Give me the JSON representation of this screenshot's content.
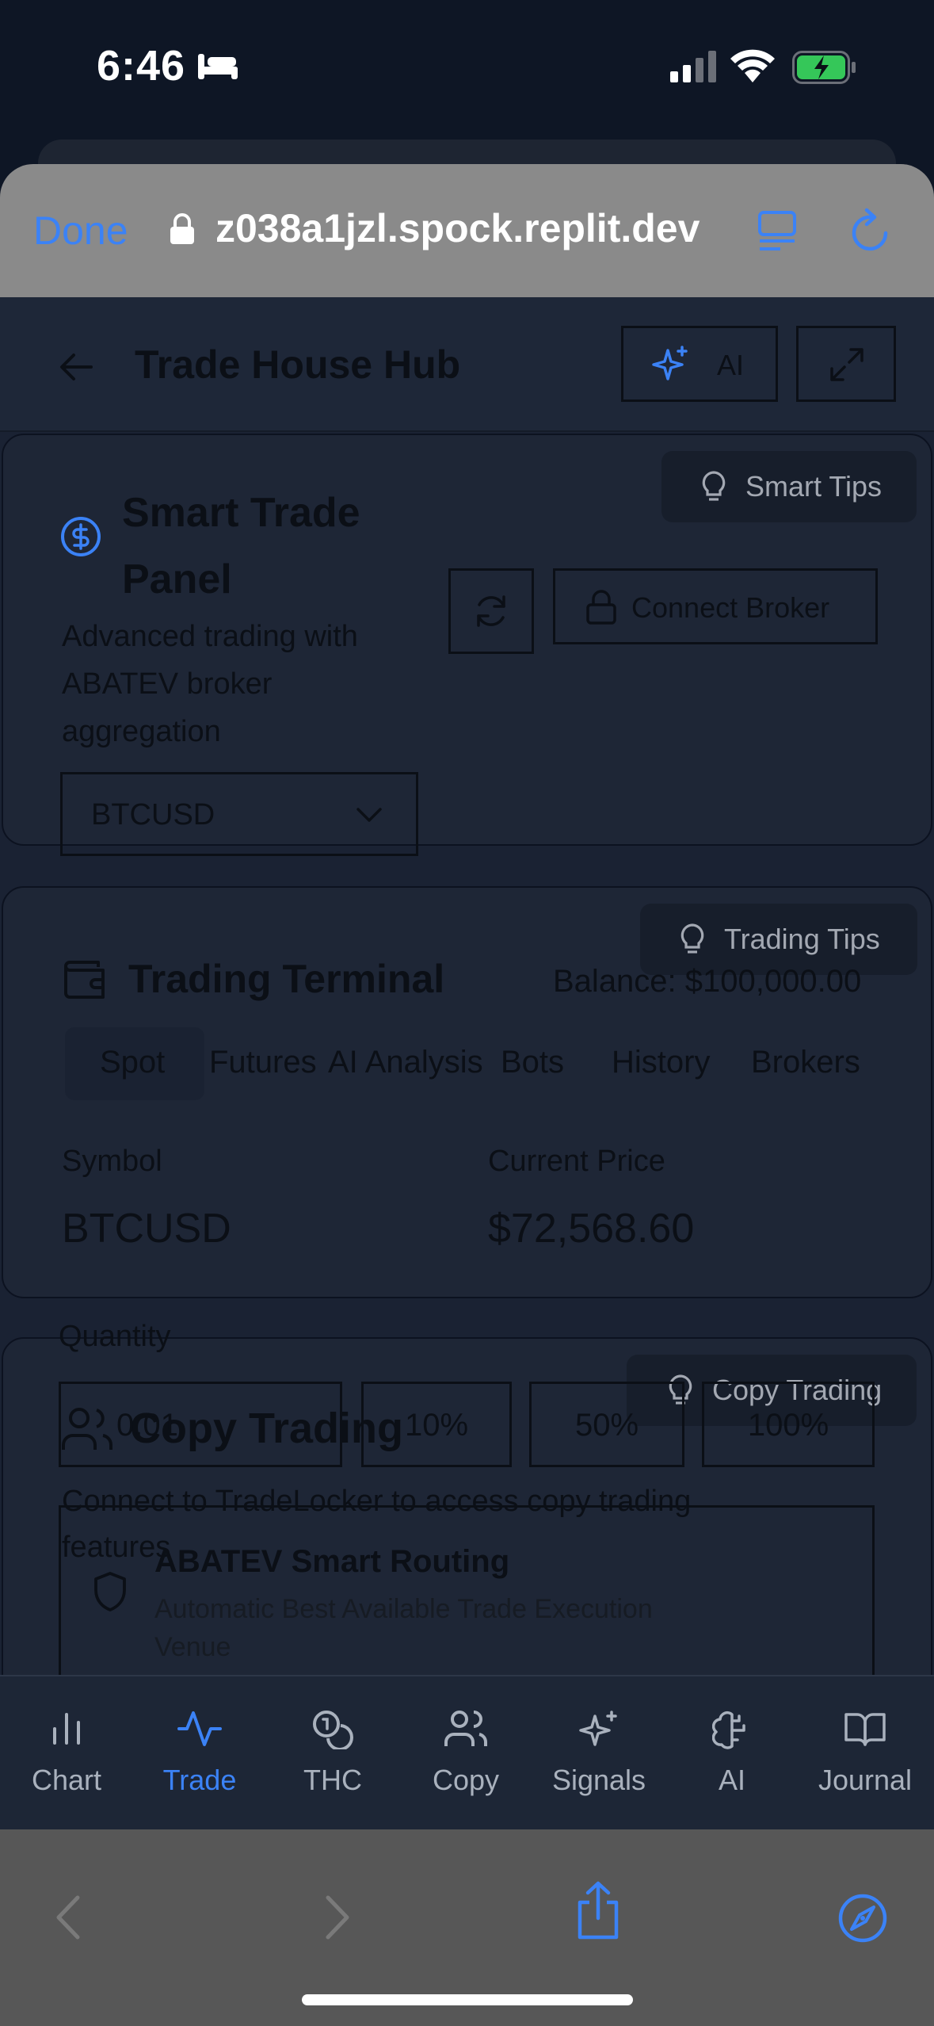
{
  "status_bar": {
    "time": "6:46"
  },
  "browser": {
    "done_label": "Done",
    "url": "z038a1jzl.spock.replit.dev"
  },
  "app_header": {
    "title": "Trade House Hub",
    "ai_label": "AI"
  },
  "smart_trade": {
    "tips_label": "Smart Tips",
    "title_line1": "Smart Trade",
    "title_line2": "Panel",
    "desc_line1": "Advanced trading with",
    "desc_line2": "ABATEV broker",
    "desc_line3": "aggregation",
    "connect_label": "Connect Broker",
    "symbol_select": "BTCUSD"
  },
  "terminal": {
    "tips_label": "Trading Tips",
    "title": "Trading Terminal",
    "balance": "Balance: $100,000.00",
    "tabs": [
      "Spot",
      "Futures",
      "AI Analysis",
      "Bots",
      "History",
      "Brokers"
    ],
    "symbol_label": "Symbol",
    "symbol_value": "BTCUSD",
    "price_label": "Current Price",
    "price_value": "$72,568.60",
    "quantity_label": "Quantity",
    "quantity_value": "0.01",
    "pct_buttons": [
      "10%",
      "50%",
      "100%"
    ],
    "routing_title": "ABATEV Smart Routing",
    "routing_desc_line1": "Automatic Best Available Trade Execution",
    "routing_desc_line2": "Venue"
  },
  "copy_trading": {
    "tips_label": "Copy Trading",
    "title": "Copy Trading",
    "desc_line1": "Connect to TradeLocker to access copy trading",
    "desc_line2": "features"
  },
  "tabbar": {
    "items": [
      {
        "label": "Chart",
        "icon": "bar-chart-icon"
      },
      {
        "label": "Trade",
        "icon": "activity-icon"
      },
      {
        "label": "THC",
        "icon": "coins-icon"
      },
      {
        "label": "Copy",
        "icon": "users-icon"
      },
      {
        "label": "Signals",
        "icon": "sparkles-icon"
      },
      {
        "label": "AI",
        "icon": "brain-icon"
      },
      {
        "label": "Journal",
        "icon": "book-icon"
      }
    ],
    "active": "Trade"
  },
  "colors": {
    "accent": "#3b82f6",
    "bg_dark": "#0e1625",
    "card": "#1e2636",
    "toolbar": "#575757"
  }
}
